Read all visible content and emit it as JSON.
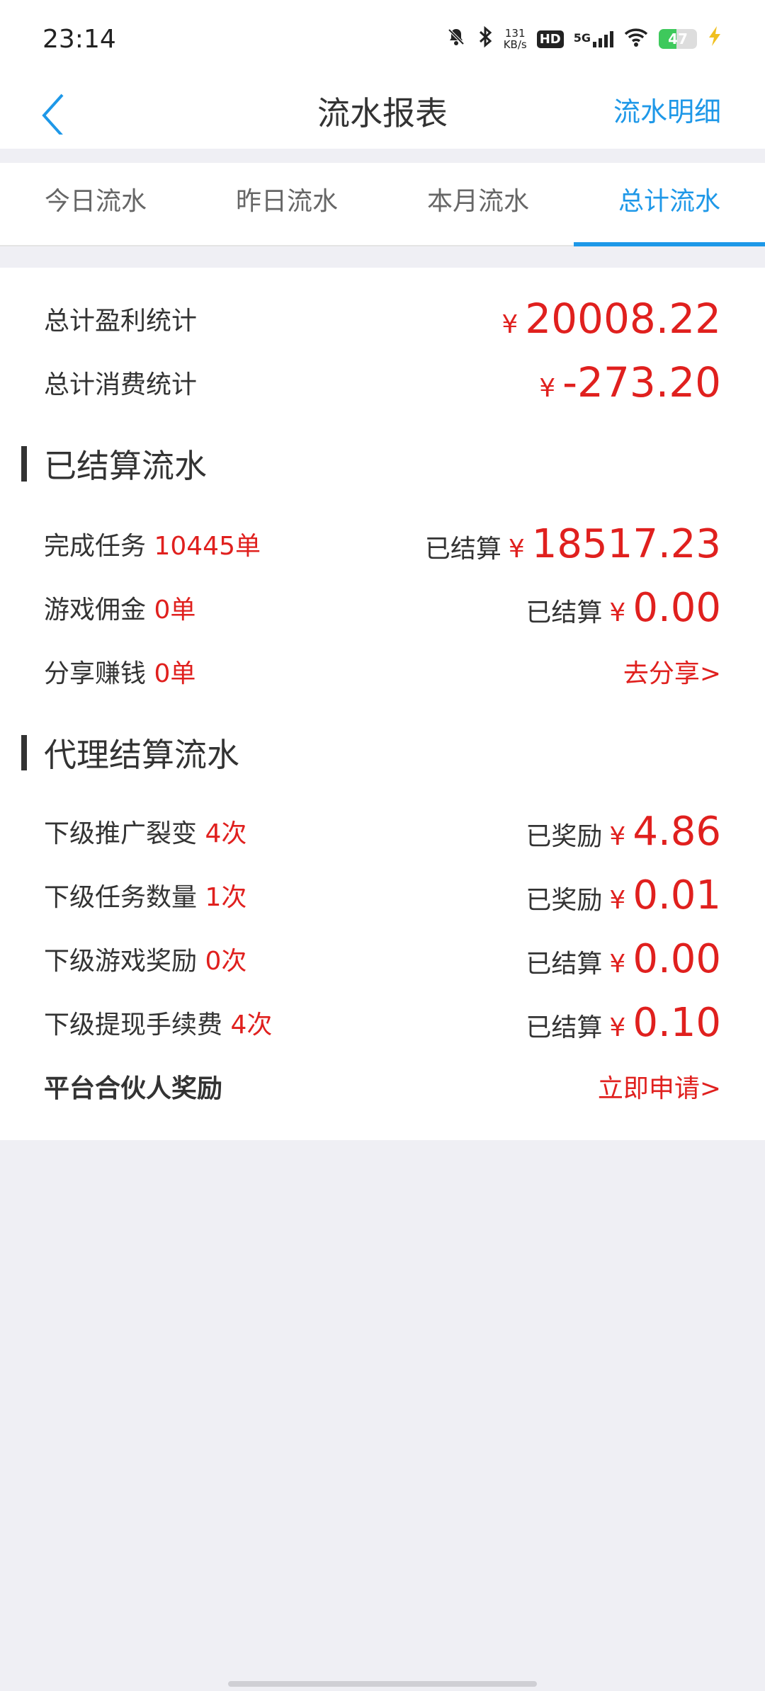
{
  "status": {
    "time": "23:14",
    "net_speed_num": "131",
    "net_speed_unit": "KB/s",
    "hd": "HD",
    "net": "5G",
    "battery": "47",
    "battery_level": 0.47
  },
  "nav": {
    "title": "流水报表",
    "right": "流水明细"
  },
  "tabs": [
    "今日流水",
    "昨日流水",
    "本月流水",
    "总计流水"
  ],
  "active_tab": 3,
  "summary": {
    "profit_label": "总计盈利统计",
    "profit_currency": "¥",
    "profit_value": "20008.22",
    "consume_label": "总计消费统计",
    "consume_currency": "¥",
    "consume_value": "-273.20"
  },
  "settled": {
    "title": "已结算流水",
    "rows": [
      {
        "label": "完成任务",
        "count": "10445单",
        "status": "已结算",
        "currency": "¥",
        "amount": "18517.23"
      },
      {
        "label": "游戏佣金",
        "count": "0单",
        "status": "已结算",
        "currency": "¥",
        "amount": "0.00"
      },
      {
        "label": "分享赚钱",
        "count": "0单",
        "action": "去分享>"
      }
    ]
  },
  "agent": {
    "title": "代理结算流水",
    "rows": [
      {
        "label": "下级推广裂变",
        "count": "4次",
        "status": "已奖励",
        "currency": "¥",
        "amount": "4.86"
      },
      {
        "label": "下级任务数量",
        "count": "1次",
        "status": "已奖励",
        "currency": "¥",
        "amount": "0.01"
      },
      {
        "label": "下级游戏奖励",
        "count": "0次",
        "status": "已结算",
        "currency": "¥",
        "amount": "0.00"
      },
      {
        "label": "下级提现手续费",
        "count": "4次",
        "status": "已结算",
        "currency": "¥",
        "amount": "0.10"
      }
    ],
    "partner_label": "平台合伙人奖励",
    "partner_action": "立即申请>"
  }
}
